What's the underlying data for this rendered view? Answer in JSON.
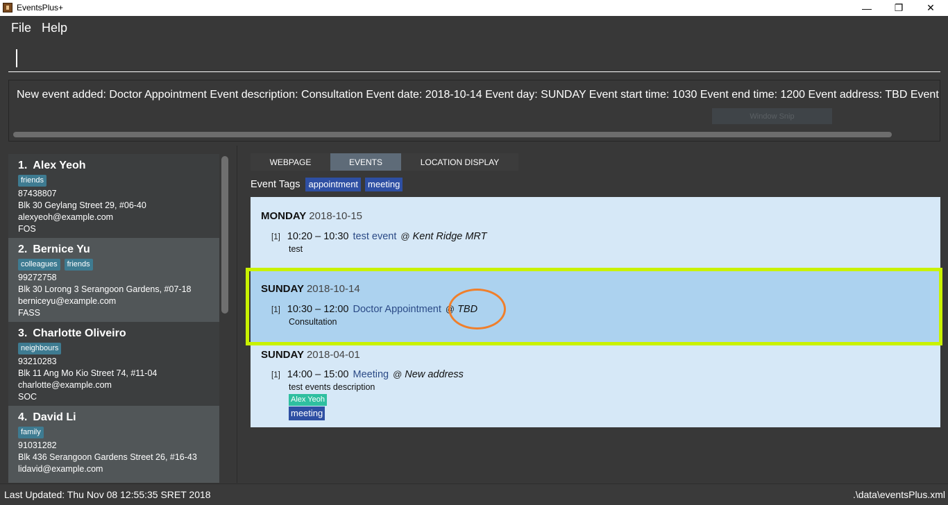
{
  "window": {
    "title": "EventsPlus+",
    "minimize_glyph": "—",
    "restore_glyph": "❐",
    "close_glyph": "✕"
  },
  "menu": {
    "file": "File",
    "help": "Help"
  },
  "command": {
    "value": ""
  },
  "result": {
    "text": "New event added: Doctor Appointment Event description: Consultation Event date: 2018-10-14 Event day: SUNDAY Event start time: 1030 Event end time: 1200 Event address: TBD Event",
    "snip_overlay": "Window Snip"
  },
  "persons": [
    {
      "index": "1.",
      "name": "Alex Yeoh",
      "tags": [
        "friends"
      ],
      "phone": "87438807",
      "address": "Blk 30 Geylang Street 29, #06-40",
      "email": "alexyeoh@example.com",
      "faculty": "FOS"
    },
    {
      "index": "2.",
      "name": "Bernice Yu",
      "tags": [
        "colleagues",
        "friends"
      ],
      "phone": "99272758",
      "address": "Blk 30 Lorong 3 Serangoon Gardens, #07-18",
      "email": "berniceyu@example.com",
      "faculty": "FASS"
    },
    {
      "index": "3.",
      "name": "Charlotte Oliveiro",
      "tags": [
        "neighbours"
      ],
      "phone": "93210283",
      "address": "Blk 11 Ang Mo Kio Street 74, #11-04",
      "email": "charlotte@example.com",
      "faculty": "SOC"
    },
    {
      "index": "4.",
      "name": "David Li",
      "tags": [
        "family"
      ],
      "phone": "91031282",
      "address": "Blk 436 Serangoon Gardens Street 26, #16-43",
      "email": "lidavid@example.com",
      "faculty": ""
    }
  ],
  "tabs": [
    {
      "label": "WEBPAGE",
      "active": false
    },
    {
      "label": "EVENTS",
      "active": true
    },
    {
      "label": "LOCATION DISPLAY",
      "active": false
    }
  ],
  "event_tags": {
    "label": "Event Tags",
    "tags": [
      "appointment",
      "meeting"
    ]
  },
  "event_days": [
    {
      "day": "MONDAY",
      "date": "2018-10-15",
      "events": [
        {
          "index": "[1]",
          "time": "10:20 – 10:30",
          "name": "test event",
          "at": "@",
          "address": "Kent Ridge MRT",
          "description": "test"
        }
      ]
    },
    {
      "day": "SUNDAY",
      "date": "2018-10-14",
      "selected": true,
      "events": [
        {
          "index": "[1]",
          "time": "10:30 – 12:00",
          "name": "Doctor Appointment",
          "at": "@",
          "address": "TBD",
          "description": "Consultation"
        }
      ]
    },
    {
      "day": "SUNDAY",
      "date": "2018-04-01",
      "events": [
        {
          "index": "[1]",
          "time": "14:00 – 15:00",
          "name": "Meeting",
          "at": "@",
          "address": "New address",
          "description": "test events description",
          "person_tags": [
            "Alex Yeoh"
          ],
          "tags": [
            "meeting"
          ]
        }
      ]
    }
  ],
  "status": {
    "last_updated": "Last Updated: Thu Nov 08 12:55:35 SRET 2018",
    "file_path": ".\\data\\eventsPlus.xml"
  },
  "colors": {
    "background": "#383838",
    "events_panel": "#d6e8f7",
    "selected_event": "#acd2ef",
    "highlight_annotation": "#c9f200",
    "circle_annotation": "#f07f2b",
    "person_tag": "#3e7b91",
    "event_tag": "#2e4fa3"
  }
}
